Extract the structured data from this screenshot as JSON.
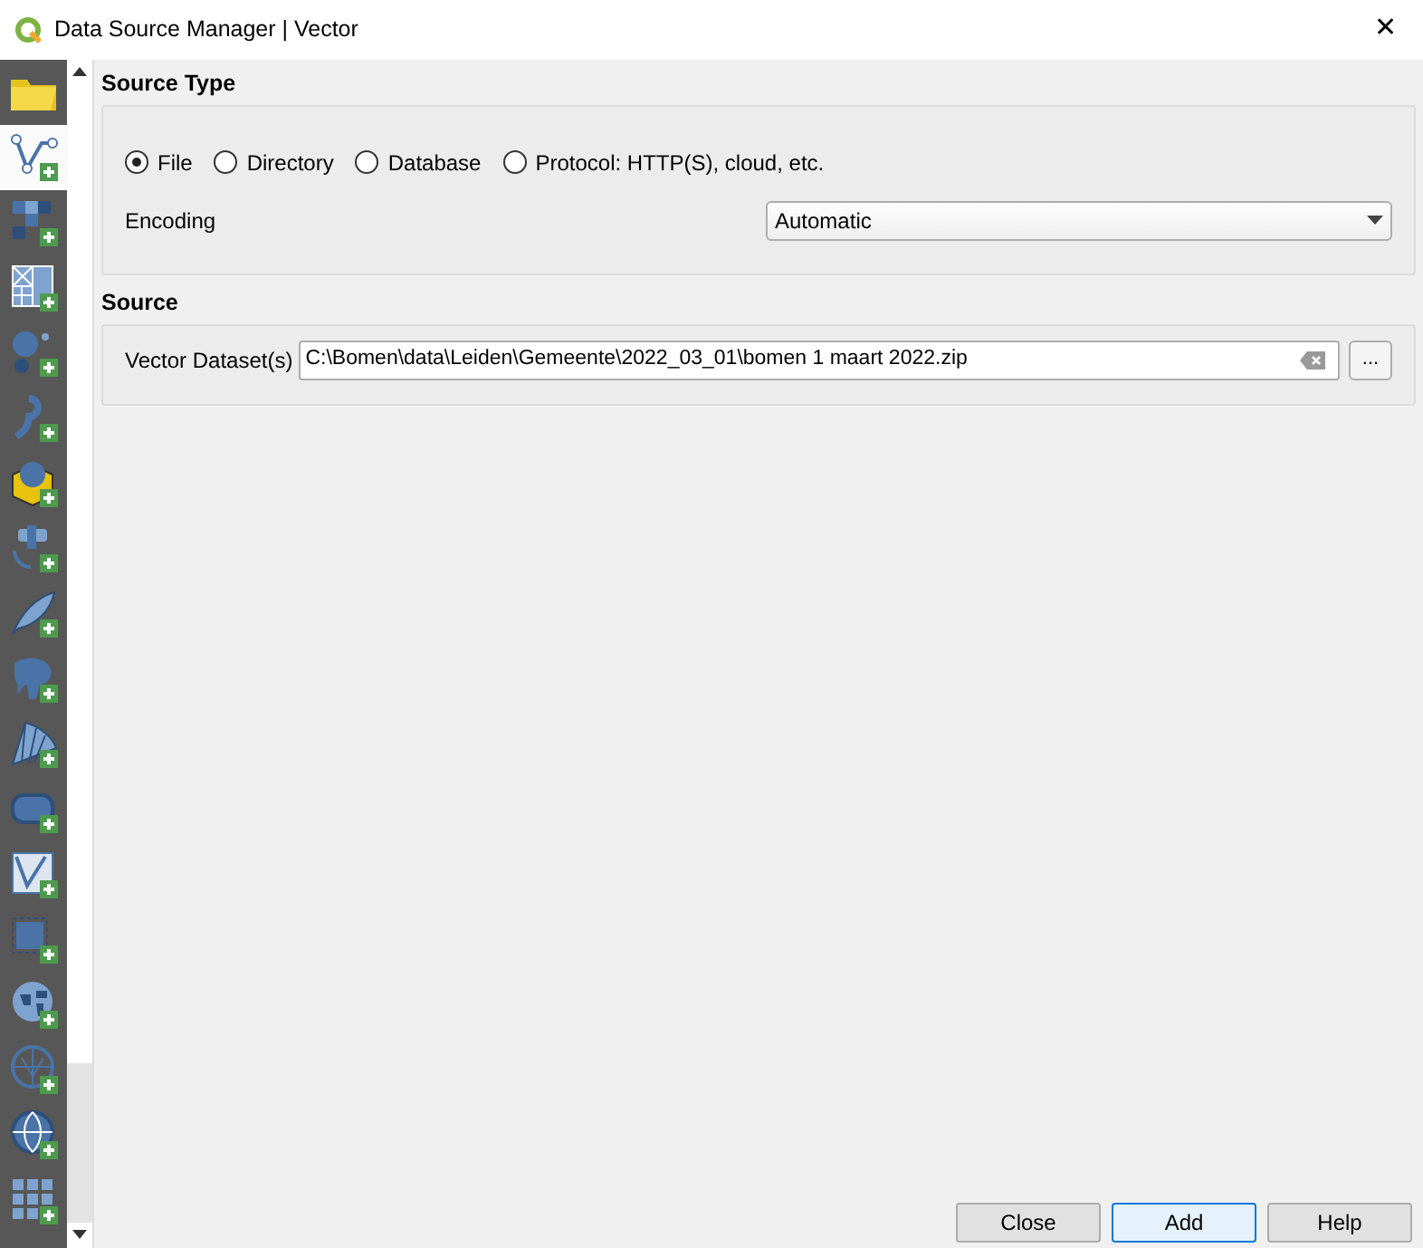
{
  "window": {
    "title": "Data Source Manager | Vector",
    "close": "✕"
  },
  "sidebar": {
    "items": [
      {
        "kind": "folder",
        "selected": false
      },
      {
        "kind": "vector",
        "selected": true
      },
      {
        "kind": "raster",
        "selected": false
      },
      {
        "kind": "mesh",
        "selected": false
      },
      {
        "kind": "points",
        "selected": false
      },
      {
        "kind": "delimited",
        "selected": false
      },
      {
        "kind": "geopackage",
        "selected": false
      },
      {
        "kind": "gps",
        "selected": false
      },
      {
        "kind": "feather",
        "selected": false
      },
      {
        "kind": "elephant",
        "selected": false
      },
      {
        "kind": "sail",
        "selected": false
      },
      {
        "kind": "rounded",
        "selected": false
      },
      {
        "kind": "virtual",
        "selected": false
      },
      {
        "kind": "square",
        "selected": false
      },
      {
        "kind": "globe-map",
        "selected": false
      },
      {
        "kind": "globe-net",
        "selected": false
      },
      {
        "kind": "globe",
        "selected": false
      },
      {
        "kind": "grid",
        "selected": false
      }
    ]
  },
  "source_type": {
    "title": "Source Type",
    "options": [
      {
        "label": "File",
        "selected": true
      },
      {
        "label": "Directory",
        "selected": false
      },
      {
        "label": "Database",
        "selected": false
      },
      {
        "label": "Protocol: HTTP(S), cloud, etc.",
        "selected": false
      }
    ],
    "encoding": {
      "label": "Encoding",
      "value": "Automatic"
    }
  },
  "source": {
    "title": "Source",
    "label": "Vector Dataset(s)",
    "value": "C:\\Bomen\\data\\Leiden\\Gemeente\\2022_03_01\\bomen 1 maart 2022.zip",
    "browse": "..."
  },
  "buttons": [
    {
      "label": "Close",
      "selected": false
    },
    {
      "label": "Add",
      "selected": true
    },
    {
      "label": "Help",
      "selected": false
    }
  ]
}
